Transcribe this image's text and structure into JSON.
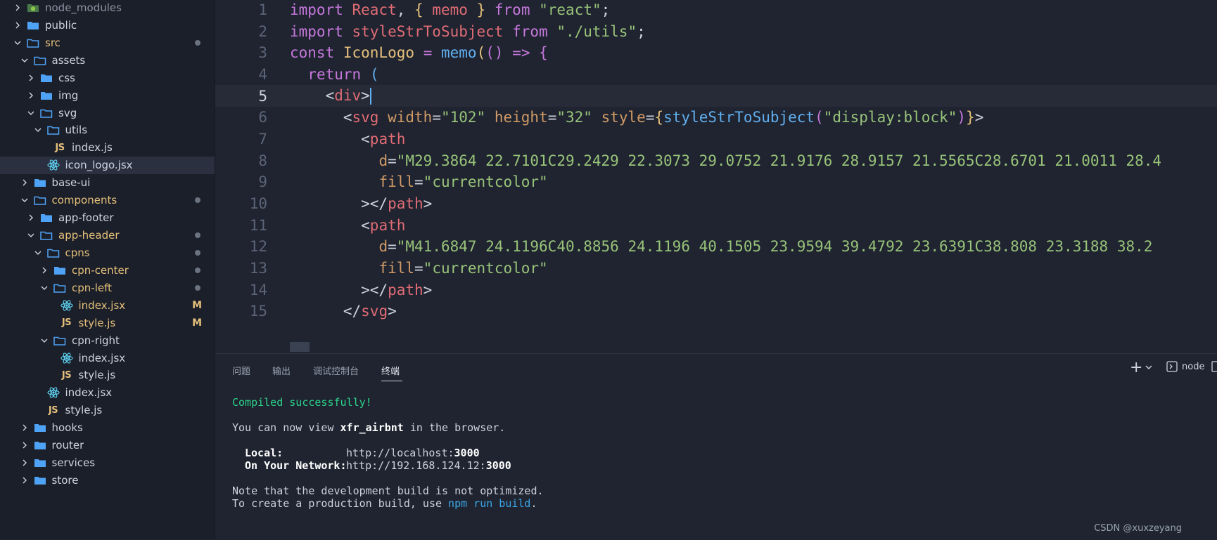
{
  "explorer": {
    "items": [
      {
        "label": "node_modules",
        "type": "folder-special",
        "depth": 0,
        "expanded": false,
        "status": "",
        "dimmed": true
      },
      {
        "label": "public",
        "type": "folder",
        "depth": 0,
        "expanded": false,
        "status": ""
      },
      {
        "label": "src",
        "type": "folder",
        "depth": 0,
        "expanded": true,
        "status": "dot",
        "modified": true
      },
      {
        "label": "assets",
        "type": "folder",
        "depth": 1,
        "expanded": true,
        "status": ""
      },
      {
        "label": "css",
        "type": "folder",
        "depth": 2,
        "expanded": false,
        "status": ""
      },
      {
        "label": "img",
        "type": "folder",
        "depth": 2,
        "expanded": false,
        "status": ""
      },
      {
        "label": "svg",
        "type": "folder",
        "depth": 2,
        "expanded": true,
        "status": ""
      },
      {
        "label": "utils",
        "type": "folder",
        "depth": 3,
        "expanded": true,
        "status": ""
      },
      {
        "label": "index.js",
        "type": "js",
        "depth": 4,
        "status": ""
      },
      {
        "label": "icon_logo.jsx",
        "type": "react",
        "depth": 3,
        "status": "",
        "selected": true
      },
      {
        "label": "base-ui",
        "type": "folder",
        "depth": 1,
        "expanded": false,
        "status": ""
      },
      {
        "label": "components",
        "type": "folder",
        "depth": 1,
        "expanded": true,
        "status": "dot",
        "modified": true
      },
      {
        "label": "app-footer",
        "type": "folder",
        "depth": 2,
        "expanded": false,
        "status": ""
      },
      {
        "label": "app-header",
        "type": "folder",
        "depth": 2,
        "expanded": true,
        "status": "dot",
        "modified": true
      },
      {
        "label": "cpns",
        "type": "folder",
        "depth": 3,
        "expanded": true,
        "status": "dot",
        "modified": true
      },
      {
        "label": "cpn-center",
        "type": "folder",
        "depth": 4,
        "expanded": false,
        "status": "dot",
        "modified": true
      },
      {
        "label": "cpn-left",
        "type": "folder",
        "depth": 4,
        "expanded": true,
        "status": "dot",
        "modified": true
      },
      {
        "label": "index.jsx",
        "type": "react",
        "depth": 5,
        "status": "M",
        "modified": true
      },
      {
        "label": "style.js",
        "type": "js",
        "depth": 5,
        "status": "M",
        "modified": true
      },
      {
        "label": "cpn-right",
        "type": "folder",
        "depth": 4,
        "expanded": true,
        "status": ""
      },
      {
        "label": "index.jsx",
        "type": "react",
        "depth": 5,
        "status": ""
      },
      {
        "label": "style.js",
        "type": "js",
        "depth": 5,
        "status": ""
      },
      {
        "label": "index.jsx",
        "type": "react",
        "depth": 3,
        "status": ""
      },
      {
        "label": "style.js",
        "type": "js",
        "depth": 3,
        "status": ""
      },
      {
        "label": "hooks",
        "type": "folder",
        "depth": 1,
        "expanded": false,
        "status": ""
      },
      {
        "label": "router",
        "type": "folder",
        "depth": 1,
        "expanded": false,
        "status": ""
      },
      {
        "label": "services",
        "type": "folder",
        "depth": 1,
        "expanded": false,
        "status": ""
      },
      {
        "label": "store",
        "type": "folder",
        "depth": 1,
        "expanded": false,
        "status": ""
      }
    ]
  },
  "editor": {
    "current_line": 5,
    "lines": [
      {
        "n": "1",
        "tokens": [
          [
            "k",
            "import"
          ],
          [
            "p",
            " "
          ],
          [
            "v",
            "React"
          ],
          [
            "p",
            ", "
          ],
          [
            "y",
            "{"
          ],
          [
            "p",
            " "
          ],
          [
            "v",
            "memo"
          ],
          [
            "p",
            " "
          ],
          [
            "y",
            "}"
          ],
          [
            "p",
            " "
          ],
          [
            "k",
            "from"
          ],
          [
            "p",
            " "
          ],
          [
            "s",
            "\"react\""
          ],
          [
            "p",
            ";"
          ]
        ]
      },
      {
        "n": "2",
        "tokens": [
          [
            "k",
            "import"
          ],
          [
            "p",
            " "
          ],
          [
            "v",
            "styleStrToSubject"
          ],
          [
            "p",
            " "
          ],
          [
            "k",
            "from"
          ],
          [
            "p",
            " "
          ],
          [
            "s",
            "\"./utils\""
          ],
          [
            "p",
            ";"
          ]
        ]
      },
      {
        "n": "3",
        "tokens": [
          [
            "k",
            "const"
          ],
          [
            "p",
            " "
          ],
          [
            "y",
            "IconLogo"
          ],
          [
            "p",
            " "
          ],
          [
            "o",
            "="
          ],
          [
            "p",
            " "
          ],
          [
            "f",
            "memo"
          ],
          [
            "y",
            "("
          ],
          [
            "k",
            "()"
          ],
          [
            "p",
            " "
          ],
          [
            "k",
            "=>"
          ],
          [
            "p",
            " "
          ],
          [
            "k",
            "{"
          ]
        ]
      },
      {
        "n": "4",
        "tokens": [
          [
            "p",
            "  "
          ],
          [
            "k",
            "return"
          ],
          [
            "p",
            " "
          ],
          [
            "f",
            "("
          ]
        ]
      },
      {
        "n": "5",
        "tokens": [
          [
            "p",
            "    "
          ],
          [
            "p",
            "<"
          ],
          [
            "v",
            "div"
          ],
          [
            "p",
            ">"
          ],
          [
            "caret",
            ""
          ]
        ]
      },
      {
        "n": "6",
        "tokens": [
          [
            "p",
            "      <"
          ],
          [
            "v",
            "svg"
          ],
          [
            "p",
            " "
          ],
          [
            "a",
            "width"
          ],
          [
            "p",
            "="
          ],
          [
            "s",
            "\"102\""
          ],
          [
            "p",
            " "
          ],
          [
            "a",
            "height"
          ],
          [
            "p",
            "="
          ],
          [
            "s",
            "\"32\""
          ],
          [
            "p",
            " "
          ],
          [
            "a",
            "style"
          ],
          [
            "p",
            "="
          ],
          [
            "y",
            "{"
          ],
          [
            "f",
            "styleStrToSubject"
          ],
          [
            "k",
            "("
          ],
          [
            "s",
            "\"display:block\""
          ],
          [
            "k",
            ")"
          ],
          [
            "y",
            "}"
          ],
          [
            "p",
            ">"
          ]
        ]
      },
      {
        "n": "7",
        "tokens": [
          [
            "p",
            "        <"
          ],
          [
            "v",
            "path"
          ]
        ]
      },
      {
        "n": "8",
        "tokens": [
          [
            "p",
            "          "
          ],
          [
            "a",
            "d"
          ],
          [
            "p",
            "="
          ],
          [
            "s",
            "\"M29.3864 22.7101C29.2429 22.3073 29.0752 21.9176 28.9157 21.5565C28.6701 21.0011 28.4"
          ]
        ]
      },
      {
        "n": "9",
        "tokens": [
          [
            "p",
            "          "
          ],
          [
            "a",
            "fill"
          ],
          [
            "p",
            "="
          ],
          [
            "s",
            "\"currentcolor\""
          ]
        ]
      },
      {
        "n": "10",
        "tokens": [
          [
            "p",
            "        ></"
          ],
          [
            "v",
            "path"
          ],
          [
            "p",
            ">"
          ]
        ]
      },
      {
        "n": "11",
        "tokens": [
          [
            "p",
            "        <"
          ],
          [
            "v",
            "path"
          ]
        ]
      },
      {
        "n": "12",
        "tokens": [
          [
            "p",
            "          "
          ],
          [
            "a",
            "d"
          ],
          [
            "p",
            "="
          ],
          [
            "s",
            "\"M41.6847 24.1196C40.8856 24.1196 40.1505 23.9594 39.4792 23.6391C38.808 23.3188 38.2"
          ]
        ]
      },
      {
        "n": "13",
        "tokens": [
          [
            "p",
            "          "
          ],
          [
            "a",
            "fill"
          ],
          [
            "p",
            "="
          ],
          [
            "s",
            "\"currentcolor\""
          ]
        ]
      },
      {
        "n": "14",
        "tokens": [
          [
            "p",
            "        ></"
          ],
          [
            "v",
            "path"
          ],
          [
            "p",
            ">"
          ]
        ]
      },
      {
        "n": "15",
        "tokens": [
          [
            "p",
            "      </"
          ],
          [
            "v",
            "svg"
          ],
          [
            "p",
            ">"
          ]
        ]
      }
    ]
  },
  "panel": {
    "tabs": [
      "问题",
      "输出",
      "调试控制台",
      "终端"
    ],
    "active_tab": "终端",
    "add_label": "+",
    "shell_label": "node",
    "terminal": {
      "compiled": "Compiled successfully!",
      "view_prefix": "You can now view ",
      "app_name": "xfr_airbnt",
      "view_suffix": " in the browser.",
      "local_label": "Local:",
      "local_url_prefix": "http://localhost:",
      "local_port": "3000",
      "network_label": "On Your Network:",
      "network_url_prefix": "http://192.168.124.12:",
      "network_port": "3000",
      "note1": "Note that the development build is not optimized.",
      "note2_prefix": "To create a production build, use ",
      "note2_cmd": "npm run build",
      "note2_suffix": "."
    }
  },
  "watermark": "CSDN @xuxzeyang",
  "colors": {
    "folder": "#4fa3f7",
    "react": "#61dafb",
    "js": "#e5c07b",
    "modified": "#e5c07b",
    "accent": "#61afef"
  }
}
